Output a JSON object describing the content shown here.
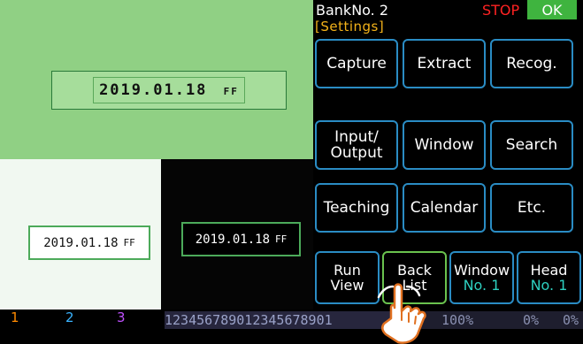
{
  "preview": {
    "main_date": "2019.01.18",
    "main_suffix": "FF",
    "left_date": "2019.01.18",
    "left_suffix": "FF",
    "right_date": "2019.01.18",
    "right_suffix": "FF"
  },
  "header": {
    "bank": "BankNo. 2",
    "mode": "[Settings]",
    "stop": "STOP",
    "ok": "OK"
  },
  "buttons": {
    "capture": "Capture",
    "extract": "Extract",
    "recog": "Recog.",
    "input_output": "Input/\nOutput",
    "window": "Window",
    "search": "Search",
    "teaching": "Teaching",
    "calendar": "Calendar",
    "etc": "Etc."
  },
  "bottom_buttons": {
    "run_view": "Run\nView",
    "back_list": "Back\nList",
    "window_label": "Window",
    "window_sub": "No. 1",
    "head_label": "Head",
    "head_sub": "No. 1"
  },
  "status": {
    "n1": "1",
    "n2": "2",
    "n3": "3",
    "sequence": "123456789012345678901",
    "pct_value": "100%",
    "pct_a": "0%",
    "pct_b": "0%",
    "digit_zero": "0"
  },
  "colors": {
    "accent_blue": "#2a8cc4",
    "ok_green": "#3fb43f",
    "stop_red": "#ff2222",
    "settings_orange": "#f3b21a"
  },
  "icons": [
    "hand-pointer-icon"
  ]
}
